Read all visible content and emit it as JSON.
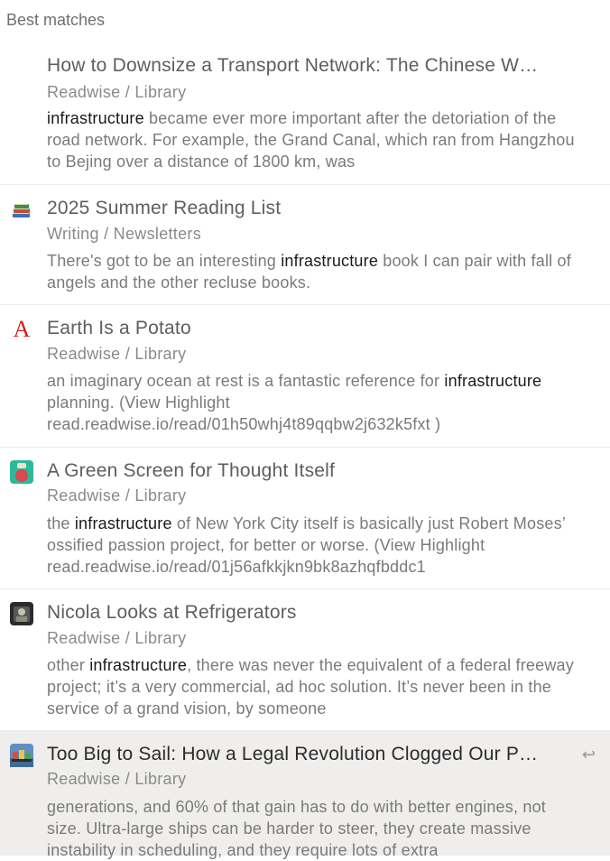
{
  "section_header": "Best matches",
  "results": [
    {
      "title": "How to Downsize a Transport Network: The Chinese W…",
      "path": "Readwise / Library",
      "snippet_before": "",
      "snippet_match": "infrastructure",
      "snippet_after": " became ever more important after the detoriation of the road network. For example, the Grand Canal, which ran from Hangzhou to Bejing over a distance of 1800 km, was",
      "icon": "none"
    },
    {
      "title": "2025 Summer Reading List",
      "path": "Writing / Newsletters",
      "snippet_before": "There's got to be an interesting ",
      "snippet_match": "infrastructure",
      "snippet_after": " book I can pair with fall of angels and the other recluse books.",
      "icon": "books-icon"
    },
    {
      "title": "Earth Is a Potato",
      "path": "Readwise / Library",
      "snippet_before": "an imaginary ocean at rest is a fantastic reference for ",
      "snippet_match": "infrastructure",
      "snippet_after": " planning. (View Highlight read.readwise.io/read/01h50whj4t89qqbw2j632k5fxt )",
      "icon": "letter-a-icon"
    },
    {
      "title": "A Green Screen for Thought Itself",
      "path": "Readwise / Library",
      "snippet_before": "the ",
      "snippet_match": "infrastructure",
      "snippet_after": " of New York City itself is basically just Robert Moses’ ossified passion project, for better or worse. (View Highlight read.readwise.io/read/01j56afkkjkn9bk8azhqfbddc1",
      "icon": "green-screen-icon"
    },
    {
      "title": "Nicola Looks at Refrigerators",
      "path": "Readwise / Library",
      "snippet_before": "other ",
      "snippet_match": "infrastructure",
      "snippet_after": ", there was never the equivalent of a federal freeway project; it’s a very commercial, ad hoc solution. It’s never been in the service of a grand vision, by someone",
      "icon": "dark-photo-icon"
    },
    {
      "title": "Too Big to Sail: How a Legal Revolution Clogged Our P…",
      "path": "Readwise / Library",
      "snippet_before": "generations, and 60% of that gain has to do with better engines, not size. Ultra-large ships can be harder to steer, they create massive instability in scheduling, and they require lots of extra",
      "snippet_match": "",
      "snippet_after": "",
      "icon": "ship-photo-icon",
      "selected": true,
      "enter_hint": "↩"
    }
  ]
}
